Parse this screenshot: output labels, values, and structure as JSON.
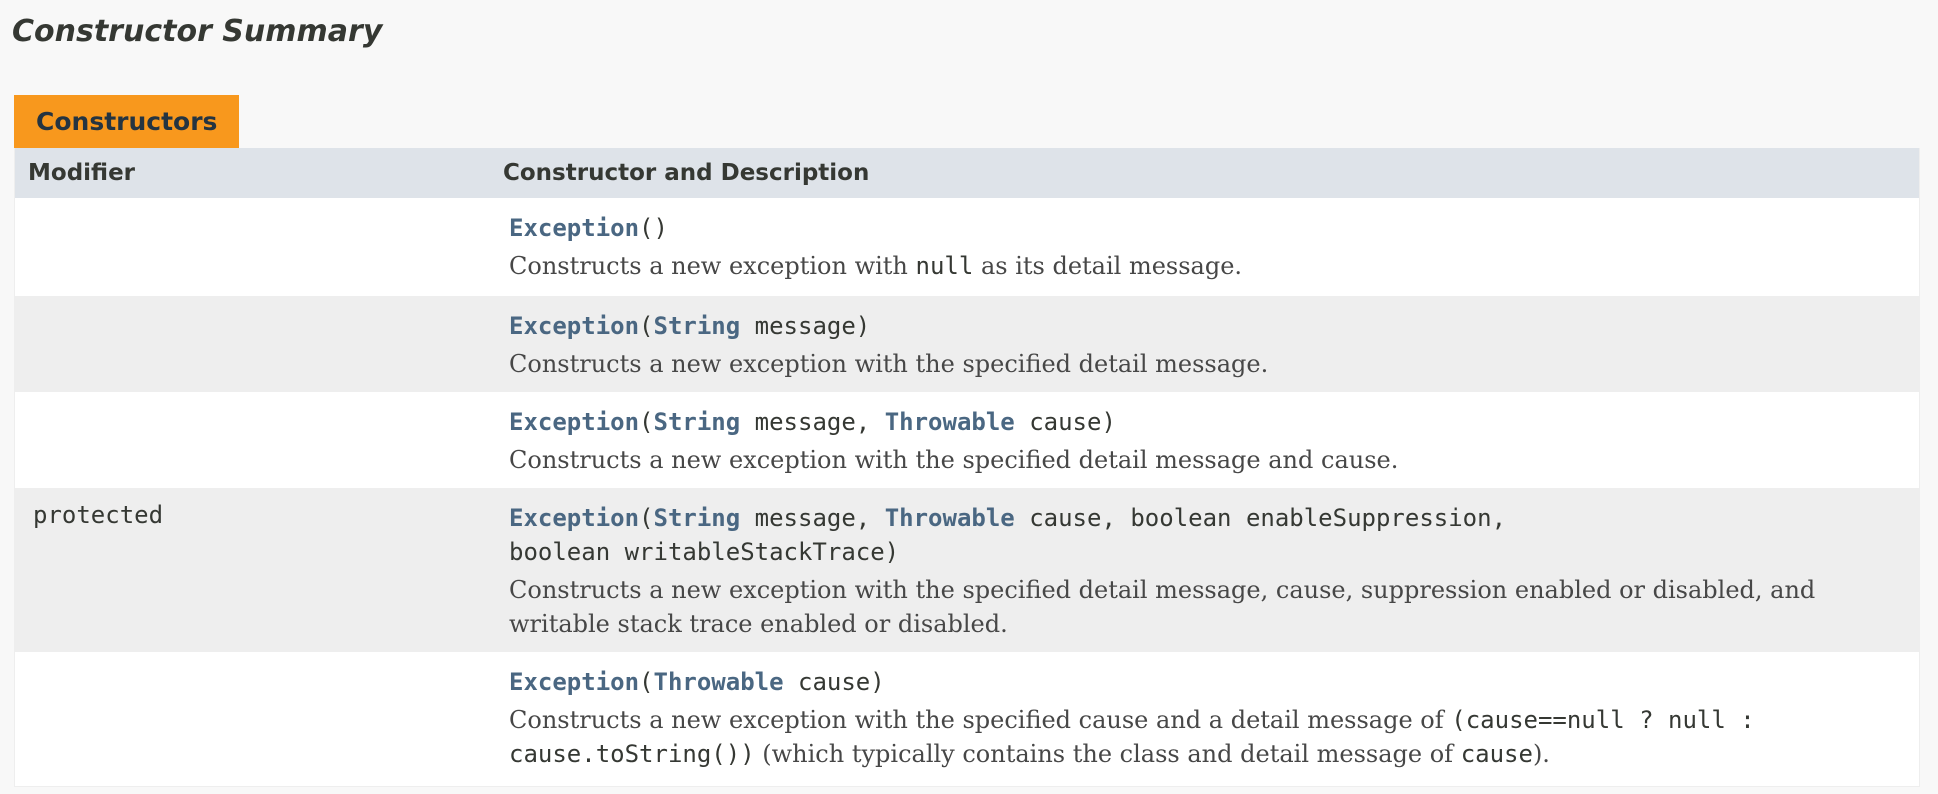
{
  "section_title": "Constructor Summary",
  "caption": "Constructors",
  "headers": {
    "modifier": "Modifier",
    "constructor": "Constructor and Description"
  },
  "rows": [
    {
      "modifier": "",
      "name": "Exception",
      "p1": "()",
      "desc1": "Constructs a new exception with ",
      "code1": "null",
      "desc2": " as its detail message."
    },
    {
      "modifier": "",
      "name": "Exception",
      "p1": "(",
      "type1": "String",
      "p2": " message)",
      "desc1": "Constructs a new exception with the specified detail message."
    },
    {
      "modifier": "",
      "name": "Exception",
      "p1": "(",
      "type1": "String",
      "p2": " message, ",
      "type2": "Throwable",
      "p3": " cause)",
      "desc1": "Constructs a new exception with the specified detail message and cause."
    },
    {
      "modifier": "protected",
      "name": "Exception",
      "p1": "(",
      "type1": "String",
      "p2": " message, ",
      "type2": "Throwable",
      "p3": " cause, boolean enableSuppression,",
      "p4": "boolean writableStackTrace)",
      "desc1": "Constructs a new exception with the specified detail message, cause, suppression enabled or disabled, and writable stack trace enabled or disabled."
    },
    {
      "modifier": "",
      "name": "Exception",
      "p1": "(",
      "type1": "Throwable",
      "p2": " cause)",
      "desc1": "Constructs a new exception with the specified cause and a detail message of ",
      "code1": "(cause==null ? null : cause.toString())",
      "desc2": " (which typically contains the class and detail message of ",
      "code2": "cause",
      "desc3": ")."
    }
  ]
}
